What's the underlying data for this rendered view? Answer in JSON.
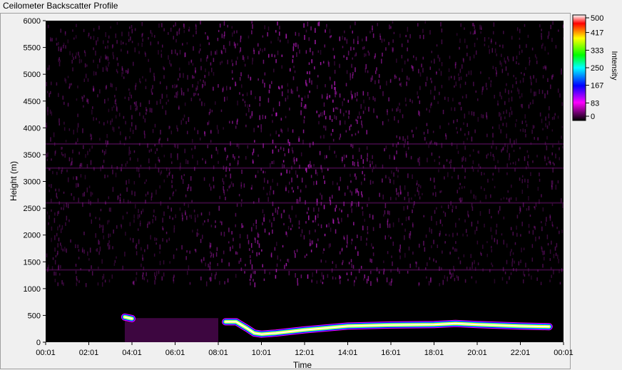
{
  "window": {
    "title": "Ceilometer Backscatter Profile"
  },
  "chart_data": {
    "type": "heatmap",
    "title": "Ceilometer Backscatter Profile",
    "xlabel": "Time",
    "ylabel": "Height (m)",
    "colorbar_label": "Intensity",
    "x_ticks": [
      "00:01",
      "02:01",
      "04:01",
      "06:01",
      "08:01",
      "10:01",
      "12:01",
      "14:01",
      "16:01",
      "18:01",
      "20:01",
      "22:01",
      "00:01"
    ],
    "y_ticks": [
      0,
      500,
      1000,
      1500,
      2000,
      2500,
      3000,
      3500,
      4000,
      4500,
      5000,
      5500,
      6000
    ],
    "ylim": [
      0,
      6000
    ],
    "colorbar_ticks": [
      0,
      83,
      167,
      250,
      333,
      417,
      500
    ],
    "colorbar_range": [
      0,
      500
    ],
    "colormap": [
      "#000000",
      "#ff00ff",
      "#0000ff",
      "#00ffff",
      "#00ff00",
      "#ffff00",
      "#ff0000",
      "#ffffff"
    ],
    "cloud_layer": {
      "times": [
        "03:41",
        "04:01",
        "08:21",
        "08:51",
        "09:21",
        "09:41",
        "10:01",
        "10:41",
        "12:01",
        "14:01",
        "16:01",
        "18:01",
        "19:01",
        "20:01",
        "22:01",
        "23:21"
      ],
      "heights_m": [
        470,
        440,
        380,
        380,
        260,
        170,
        150,
        170,
        230,
        300,
        320,
        330,
        350,
        330,
        300,
        290
      ],
      "intensity": 500
    },
    "weak_layers_m": [
      1350,
      2600,
      3250,
      3700
    ],
    "noise_level": 83
  }
}
